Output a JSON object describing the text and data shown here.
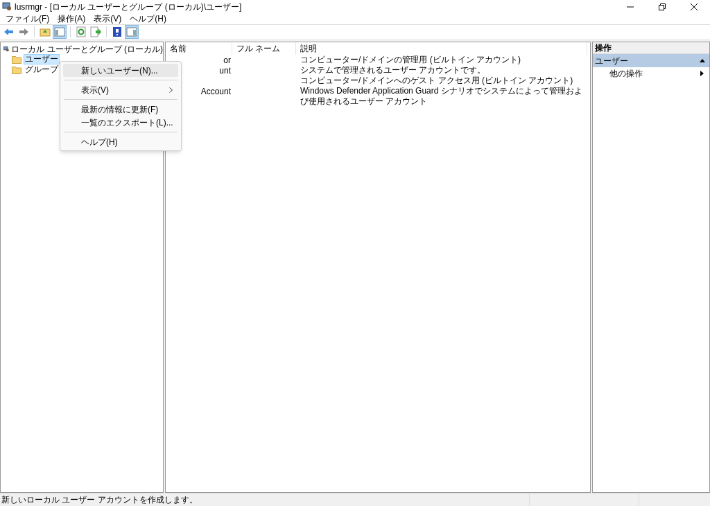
{
  "window": {
    "title": "lusrmgr - [ローカル ユーザーとグループ (ローカル)\\ユーザー]"
  },
  "menu_bar": [
    "ファイル(F)",
    "操作(A)",
    "表示(V)",
    "ヘルプ(H)"
  ],
  "toolbar": [
    {
      "kind": "back",
      "selected": false
    },
    {
      "kind": "forward",
      "selected": false
    },
    {
      "kind": "separator"
    },
    {
      "kind": "up",
      "selected": false
    },
    {
      "kind": "tree",
      "selected": true
    },
    {
      "kind": "separator"
    },
    {
      "kind": "refresh",
      "selected": false
    },
    {
      "kind": "export",
      "selected": false
    },
    {
      "kind": "separator"
    },
    {
      "kind": "help",
      "selected": false
    },
    {
      "kind": "pane",
      "selected": true
    }
  ],
  "tree": {
    "label": "ローカル ユーザーとグループ (ローカル)",
    "children": [
      {
        "label": "ユーザー",
        "selected": true
      },
      {
        "label": "グループ",
        "selected": false
      }
    ]
  },
  "table": {
    "columns": [
      "名前",
      "フル ネーム",
      "説明"
    ],
    "rows": [
      {
        "name": "or",
        "description": "コンピューター/ドメインの管理用 (ビルトイン アカウント)"
      },
      {
        "name": "unt",
        "description": "システムで管理されるユーザー アカウントです。"
      },
      {
        "description": "コンピューター/ドメインへのゲスト アクセス用 (ビルトイン アカウント)"
      },
      {
        "name": "Account",
        "description": "Windows Defender Application Guard シナリオでシステムによって管理および使用されるユーザー アカウント"
      }
    ]
  },
  "context_menu": [
    {
      "kind": "item",
      "label": "新しいユーザー(N)...",
      "selected": true
    },
    {
      "kind": "sep"
    },
    {
      "kind": "submenu",
      "label": "表示(V)",
      "selected": false
    },
    {
      "kind": "sep"
    },
    {
      "kind": "item",
      "label": "最新の情報に更新(F)",
      "selected": false
    },
    {
      "kind": "item",
      "label": "一覧のエクスポート(L)...",
      "selected": false
    },
    {
      "kind": "sep"
    },
    {
      "kind": "item",
      "label": "ヘルプ(H)",
      "selected": false
    }
  ],
  "actions": {
    "title": "操作",
    "section": {
      "label": "ユーザー",
      "expanded": true
    },
    "items": [
      "他の操作"
    ]
  },
  "status_bar": "新しいローカル ユーザー アカウントを作成します。"
}
